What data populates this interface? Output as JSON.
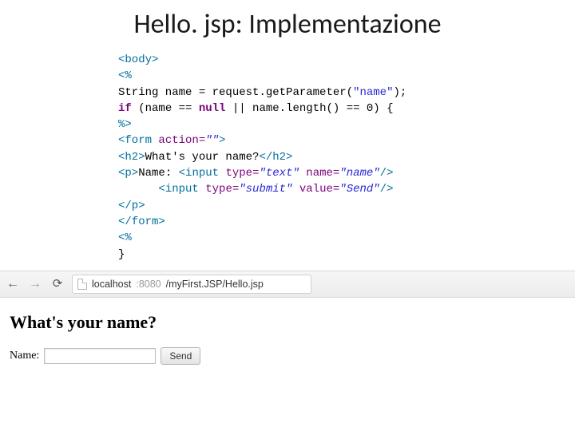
{
  "title": "Hello. jsp: Implementazione",
  "code": {
    "line1_open": "<body>",
    "line2_openjsp": "<%",
    "line3_a": "String name ",
    "line3_b": "= request.getParameter(",
    "line3_c": "\"name\"",
    "line3_d": ");",
    "line4_a": "if",
    "line4_b": " (name ",
    "line4_c": "== ",
    "line4_d": "null",
    "line4_e": " || name.length() ",
    "line4_f": "== 0) {",
    "line5_closejsp": "%>",
    "line6_a": "<form ",
    "line6_attr": "action=",
    "line6_val": "\"\"",
    "line6_b": ">",
    "line7_a": "<h2>",
    "line7_b": "What's your name?",
    "line7_c": "</h2>",
    "line8_a": "<p>",
    "line8_b": "Name: ",
    "line8_c": "<input ",
    "line8_attr1": "type=",
    "line8_val1": "\"text\"",
    "line8_sp": " ",
    "line8_attr2": "name=",
    "line8_val2": "\"name\"",
    "line8_d": "/>",
    "line9_pad": "      ",
    "line9_a": "<input ",
    "line9_attr1": "type=",
    "line9_val1": "\"submit\"",
    "line9_sp": " ",
    "line9_attr2": "value=",
    "line9_val2": "\"Send\"",
    "line9_b": "/>",
    "line10": "</p>",
    "line11": "</form>",
    "line12": "<%",
    "line13": "}"
  },
  "browser": {
    "back_glyph": "←",
    "fwd_glyph": "→",
    "reload_glyph": "⟳",
    "url_host": "localhost",
    "url_port": ":8080",
    "url_path": "/myFirst.JSP/Hello.jsp"
  },
  "page": {
    "heading": "What's your name?",
    "label": "Name:",
    "input_value": "",
    "submit_label": "Send"
  }
}
